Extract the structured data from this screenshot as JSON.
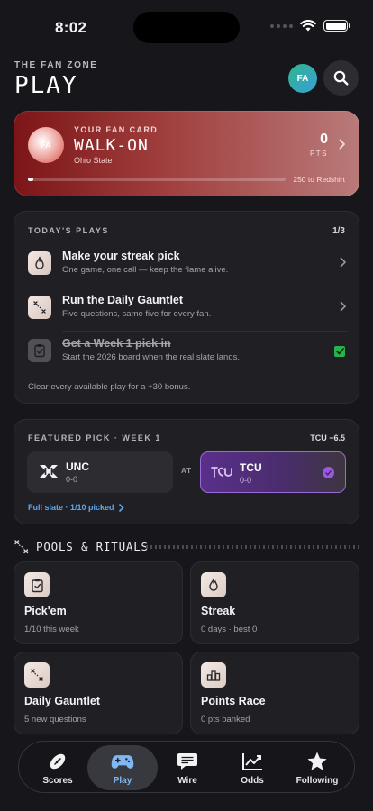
{
  "status": {
    "time": "8:02"
  },
  "header": {
    "eyebrow": "THE FAN ZONE",
    "title": "PLAY",
    "avatar_initials": "FA"
  },
  "fan_card": {
    "label": "YOUR FAN CARD",
    "avatar_initials": "FA",
    "rank": "WALK-ON",
    "team": "Ohio State",
    "points": "0",
    "points_unit": "PTS",
    "progress_fraction": 0.02,
    "progress_label": "250 to Redshirt"
  },
  "todays_plays": {
    "label": "TODAY'S PLAYS",
    "count": "1/3",
    "items": [
      {
        "title": "Make your streak pick",
        "subtitle": "One game, one call — keep the flame alive.",
        "icon": "flame-icon",
        "done": false
      },
      {
        "title": "Run the Daily Gauntlet",
        "subtitle": "Five questions, same five for every fan.",
        "icon": "play-diagram-icon",
        "done": false
      },
      {
        "title": "Get a Week 1 pick in",
        "subtitle": "Start the 2026 board when the real slate lands.",
        "icon": "clipboard-check-icon",
        "done": true
      }
    ],
    "bonus_text": "Clear every available play for a +30 bonus."
  },
  "featured_pick": {
    "label": "FEATURED PICK · WEEK 1",
    "spread": "TCU −6.5",
    "at_label": "AT",
    "away": {
      "name": "UNC",
      "record": "0-0"
    },
    "home": {
      "name": "TCU",
      "record": "0-0",
      "selected": true
    },
    "slate_link": "Full slate · 1/10 picked"
  },
  "pools": {
    "title": "POOLS & RITUALS",
    "items": [
      {
        "name": "Pick'em",
        "subtitle": "1/10 this week",
        "icon": "clipboard-check-icon"
      },
      {
        "name": "Streak",
        "subtitle": "0 days · best 0",
        "icon": "flame-icon"
      },
      {
        "name": "Daily Gauntlet",
        "subtitle": "5 new questions",
        "icon": "play-diagram-icon"
      },
      {
        "name": "Points Race",
        "subtitle": "0 pts banked",
        "icon": "podium-icon"
      }
    ]
  },
  "tabs": [
    {
      "label": "Scores",
      "icon": "football-icon",
      "active": false
    },
    {
      "label": "Play",
      "icon": "gamepad-icon",
      "active": true
    },
    {
      "label": "Wire",
      "icon": "chat-bubble-icon",
      "active": false
    },
    {
      "label": "Odds",
      "icon": "trend-chart-icon",
      "active": false
    },
    {
      "label": "Following",
      "icon": "star-icon",
      "active": false
    }
  ],
  "colors": {
    "background": "#17171b",
    "fan_card_red": "#7c1517",
    "tcu_purple": "#5a2f8b",
    "link_blue": "#5fa7ef",
    "check_green": "#28b34a"
  }
}
